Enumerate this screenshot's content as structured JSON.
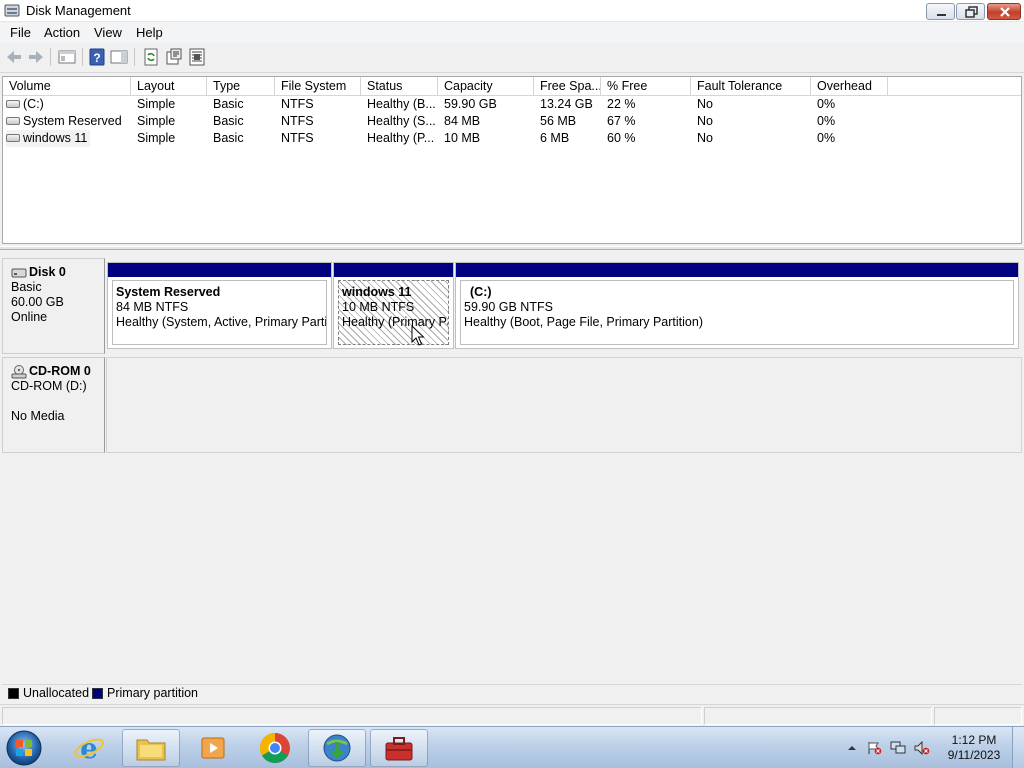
{
  "window": {
    "title": "Disk Management"
  },
  "menu": {
    "items": [
      "File",
      "Action",
      "View",
      "Help"
    ]
  },
  "toolbar": {
    "icons": [
      "back-arrow-icon",
      "forward-arrow-icon",
      "show-hide-console-icon",
      "help-icon",
      "show-hide-action-pane-icon",
      "refresh-icon",
      "properties-icon",
      "settings-icon"
    ]
  },
  "volume_list": {
    "columns": [
      "Volume",
      "Layout",
      "Type",
      "File System",
      "Status",
      "Capacity",
      "Free Spa...",
      "% Free",
      "Fault Tolerance",
      "Overhead"
    ],
    "rows": [
      {
        "volume": "(C:)",
        "layout": "Simple",
        "type": "Basic",
        "fs": "NTFS",
        "status": "Healthy (B...",
        "capacity": "59.90 GB",
        "free": "13.24 GB",
        "pct": "22 %",
        "fault": "No",
        "overhead": "0%"
      },
      {
        "volume": "System Reserved",
        "layout": "Simple",
        "type": "Basic",
        "fs": "NTFS",
        "status": "Healthy (S...",
        "capacity": "84 MB",
        "free": "56 MB",
        "pct": "67 %",
        "fault": "No",
        "overhead": "0%"
      },
      {
        "volume": "windows 11",
        "layout": "Simple",
        "type": "Basic",
        "fs": "NTFS",
        "status": "Healthy (P...",
        "capacity": "10 MB",
        "free": "6 MB",
        "pct": "60 %",
        "fault": "No",
        "overhead": "0%"
      }
    ]
  },
  "disks": {
    "disk0": {
      "name": "Disk 0",
      "type": "Basic",
      "size": "60.00 GB",
      "state": "Online",
      "partitions": [
        {
          "name": "System Reserved",
          "size": "84 MB NTFS",
          "status": "Healthy (System, Active, Primary Partitic"
        },
        {
          "name": "windows 11",
          "size": "10 MB NTFS",
          "status": "Healthy (Primary Pa"
        },
        {
          "name": "(C:)",
          "size": "59.90 GB NTFS",
          "status": "Healthy (Boot, Page File, Primary Partition)"
        }
      ]
    },
    "cdrom0": {
      "name": "CD-ROM 0",
      "drive": "CD-ROM (D:)",
      "media": "No Media"
    }
  },
  "legend": {
    "unallocated": "Unallocated",
    "primary": "Primary partition",
    "unallocated_color": "#000000",
    "primary_color": "#000080"
  },
  "taskbar": {
    "apps": [
      "internet-explorer-icon",
      "file-explorer-icon",
      "media-player-icon",
      "chrome-icon",
      "download-manager-icon",
      "toolbox-icon"
    ],
    "clock_time": "1:12 PM",
    "clock_date": "9/11/2023"
  }
}
